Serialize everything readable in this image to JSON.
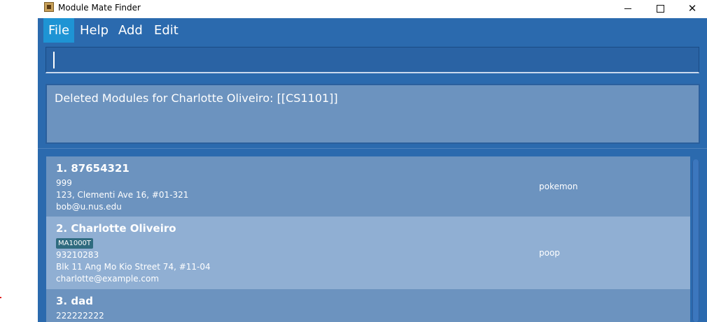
{
  "window": {
    "title": "Module Mate Finder",
    "minimize_label": "Minimize",
    "maximize_label": "Maximize",
    "close_label": "Close"
  },
  "menu": {
    "items": [
      "File",
      "Help",
      "Add",
      "Edit"
    ]
  },
  "command": {
    "value": "",
    "placeholder": ""
  },
  "result": {
    "text": "Deleted Modules for Charlotte Oliveiro: [[CS1101]]"
  },
  "people": [
    {
      "index_name": "1.  87654321",
      "modules": [],
      "phone": "999",
      "address": "123, Clementi Ave 16, #01-321",
      "email": "bob@u.nus.edu",
      "tag": "pokemon"
    },
    {
      "index_name": "2.  Charlotte Oliveiro",
      "modules": [
        "MA1000T"
      ],
      "phone": "93210283",
      "address": "Blk 11 Ang Mo Kio Street 74, #11-04",
      "email": "charlotte@example.com",
      "tag": "poop"
    },
    {
      "index_name": "3.  dad",
      "modules": [],
      "phone": "222222222",
      "address": "",
      "email": "",
      "tag": ""
    }
  ],
  "colors": {
    "accent": "#2b6aae",
    "menu_active": "#1e94d4",
    "card_dark": "#6c93bf",
    "card_light": "#90afd3"
  }
}
